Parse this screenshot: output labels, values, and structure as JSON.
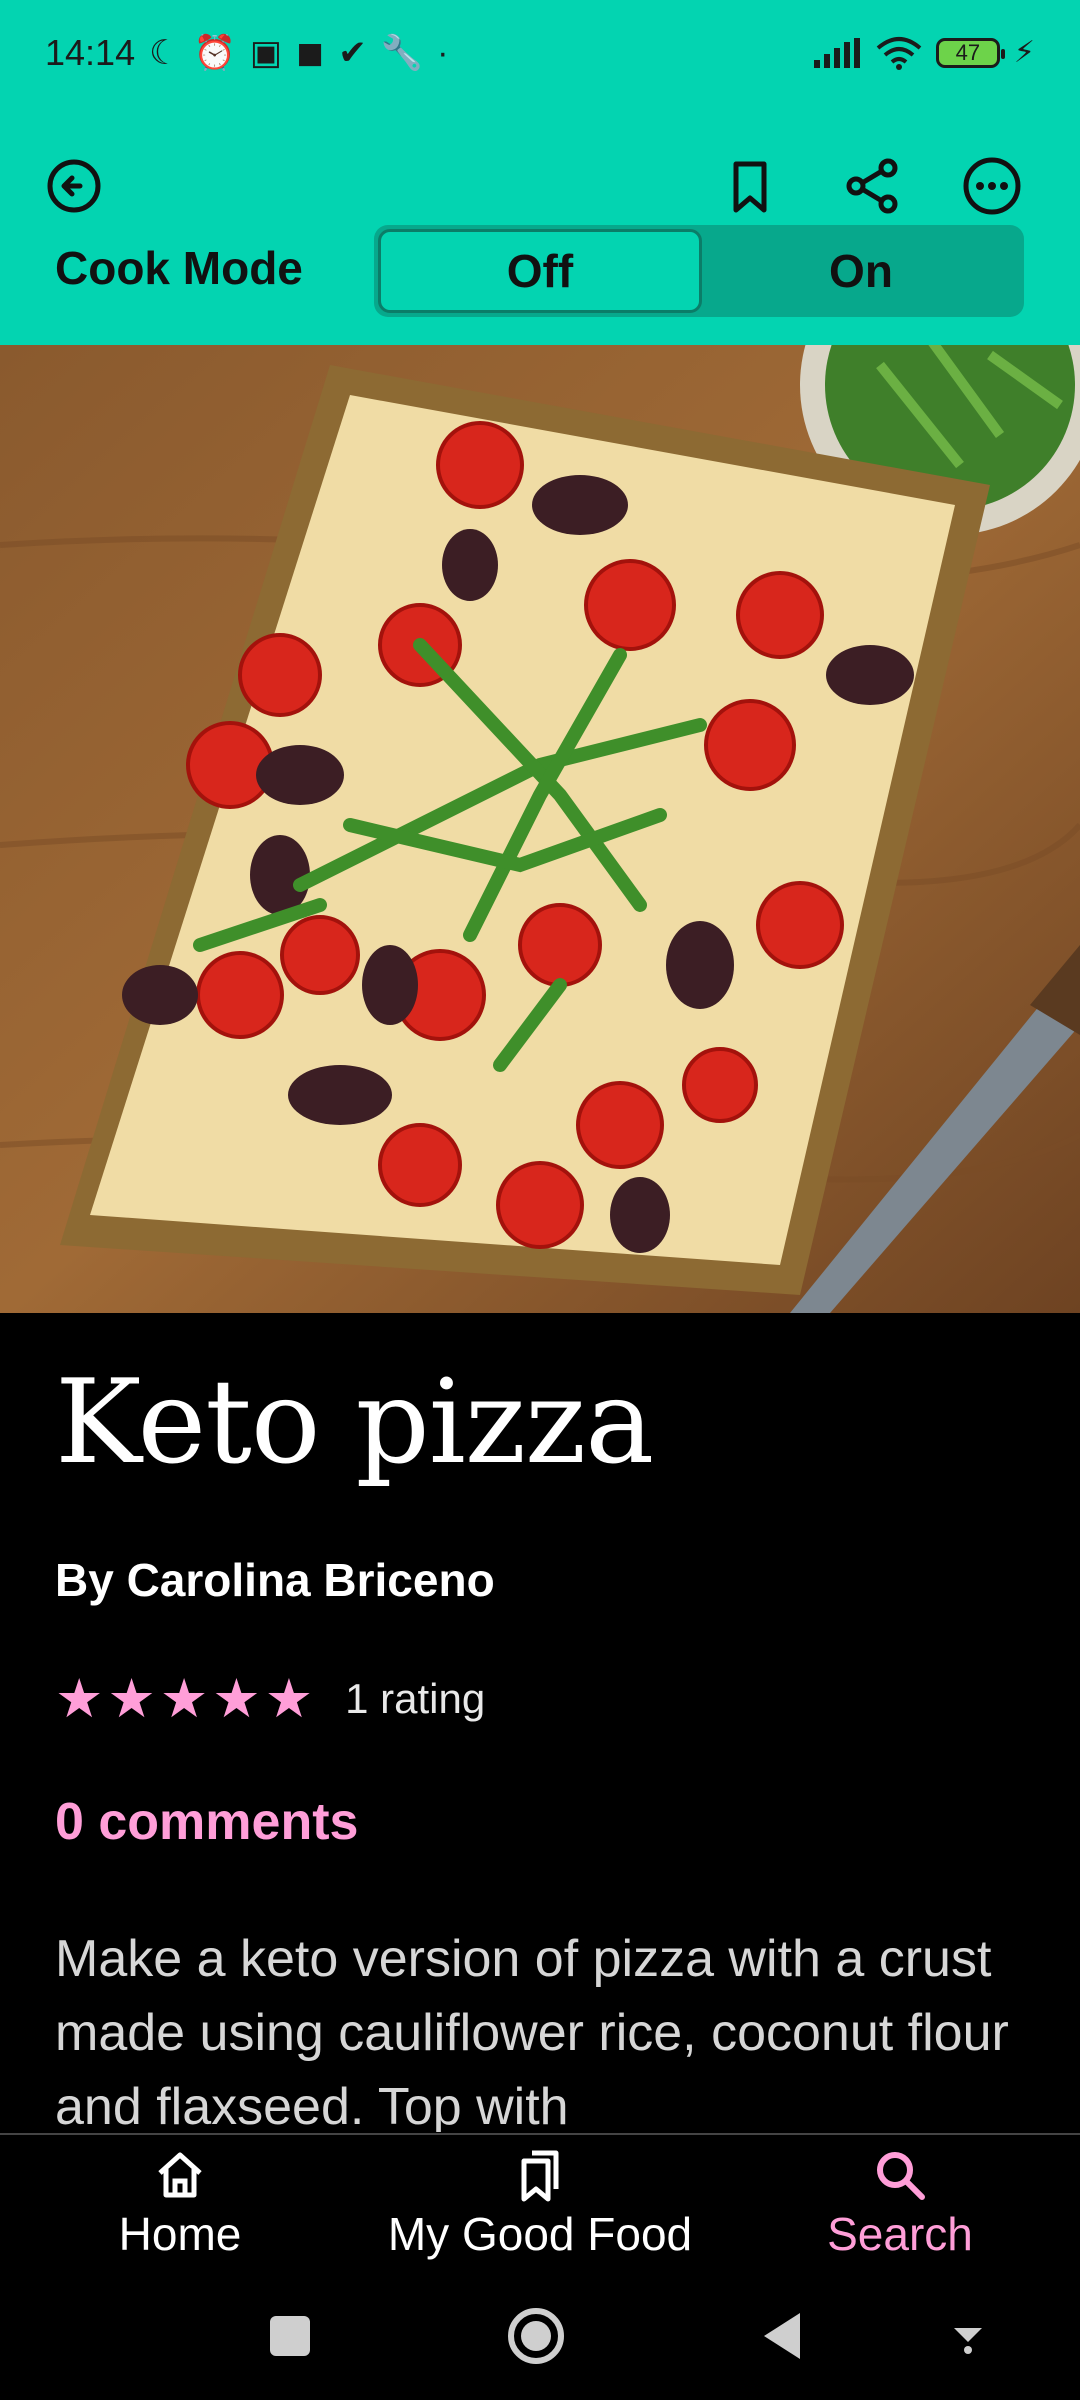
{
  "status_bar": {
    "time": "14:14",
    "battery": "47"
  },
  "header": {
    "cook_mode_label": "Cook Mode",
    "toggle": {
      "off_label": "Off",
      "on_label": "On",
      "selected": "Off"
    }
  },
  "recipe": {
    "title": "Keto pizza",
    "author": "By Carolina Briceno",
    "rating_stars": 5,
    "rating_text": "1 rating",
    "comments": "0 comments",
    "description": "Make a keto version of pizza with a crust made using cauliflower rice, coconut flour and flaxseed. Top with"
  },
  "bottom_nav": {
    "items": [
      {
        "label": "Home",
        "icon": "home-icon",
        "active": false
      },
      {
        "label": "My Good Food",
        "icon": "saved-recipes-icon",
        "active": false
      },
      {
        "label": "Search",
        "icon": "search-icon",
        "active": true
      }
    ]
  },
  "colors": {
    "accent": "#03d4b1",
    "pink": "#ff9ed8",
    "background": "#000000"
  }
}
